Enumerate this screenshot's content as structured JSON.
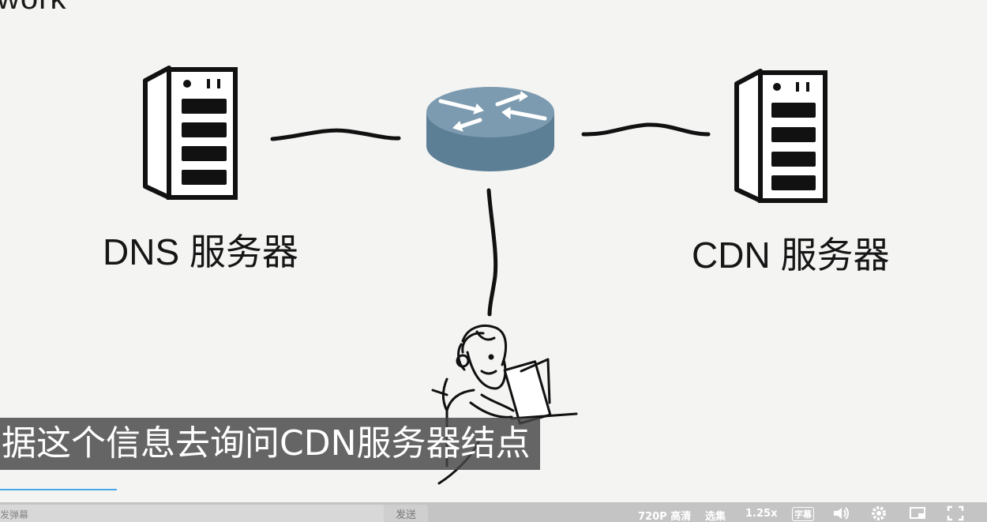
{
  "video": {
    "title_fragment": "work",
    "labels": {
      "dns": "DNS 服务器",
      "cdn": "CDN 服务器"
    },
    "subtitle": "据这个信息去询问CDN服务器结点",
    "progress_fraction": 0.118
  },
  "controls": {
    "danmu_placeholder": "发弹幕",
    "send_label": "发送",
    "quality": "720P 高清",
    "episodes": "选集",
    "speed": "1.25x",
    "subtitle_toggle": "字幕",
    "icons": [
      "volume-icon",
      "settings-icon",
      "picture-in-picture-icon",
      "fullscreen-icon"
    ]
  }
}
